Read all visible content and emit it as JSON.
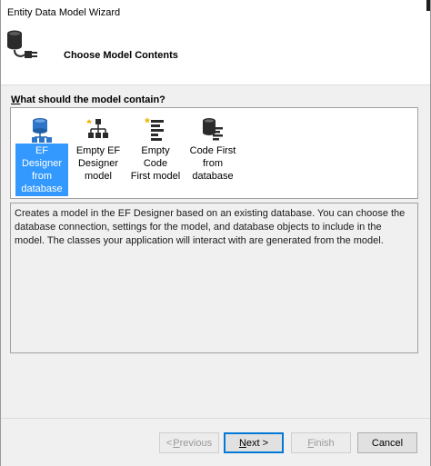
{
  "window": {
    "title": "Entity Data Model Wizard"
  },
  "header": {
    "title": "Choose Model Contents",
    "icon": "database-plug-icon"
  },
  "question": {
    "prefix": "W",
    "text": "hat should the model contain?"
  },
  "model_options": [
    {
      "line1": "EF Designer",
      "line2": "from",
      "line3": "database",
      "icon": "ef-designer-database-icon",
      "selected": true
    },
    {
      "line1": "Empty EF",
      "line2": "Designer",
      "line3": "model",
      "icon": "empty-designer-icon",
      "selected": false
    },
    {
      "line1": "Empty Code",
      "line2": "First model",
      "line3": "",
      "icon": "empty-code-first-icon",
      "selected": false
    },
    {
      "line1": "Code First",
      "line2": "from",
      "line3": "database",
      "icon": "code-first-database-icon",
      "selected": false
    }
  ],
  "description": "Creates a model in the EF Designer based on an existing database. You can choose the database connection, settings for the model, and database objects to include in the model. The classes your application will interact with are generated from the model.",
  "buttons": {
    "previous_pre": "< ",
    "previous_mn": "P",
    "previous_post": "revious",
    "next_mn": "N",
    "next_post": "ext >",
    "finish_mn": "F",
    "finish_post": "inish",
    "cancel": "Cancel"
  },
  "colors": {
    "selection": "#3399ff",
    "default_button_border": "#0078d7"
  }
}
